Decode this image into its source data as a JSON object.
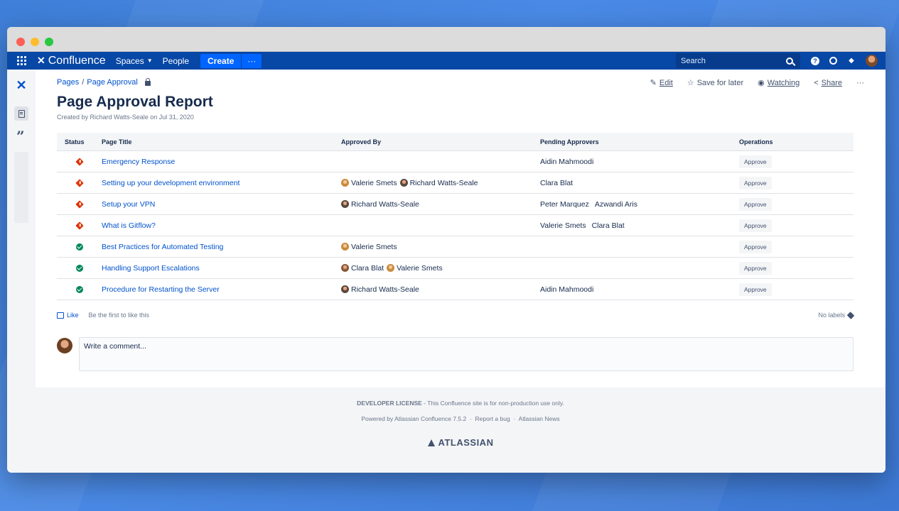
{
  "topnav": {
    "product": "Confluence",
    "spaces": "Spaces",
    "people": "People",
    "create": "Create",
    "more": "···",
    "search_placeholder": "Search"
  },
  "breadcrumb": {
    "root": "Pages",
    "sep": "/",
    "current": "Page Approval"
  },
  "actions": {
    "edit": "Edit",
    "save_later": "Save for later",
    "watching": "Watching",
    "share": "Share",
    "more": "···"
  },
  "page": {
    "title": "Page Approval Report",
    "byline": "Created by Richard Watts-Seale on Jul 31, 2020"
  },
  "table": {
    "headers": [
      "Status",
      "Page Title",
      "Approved By",
      "Pending Approvers",
      "Operations"
    ],
    "approve_label": "Approve",
    "rows": [
      {
        "status": "pending",
        "title": "Emergency Response",
        "approved": [],
        "pending": [
          "Aidin Mahmoodi"
        ]
      },
      {
        "status": "pending",
        "title": "Setting up your development environment",
        "approved": [
          {
            "name": "Valerie Smets",
            "avatar": "valerie"
          },
          {
            "name": "Richard Watts-Seale",
            "avatar": "richard"
          }
        ],
        "pending": [
          "Clara Blat"
        ]
      },
      {
        "status": "pending",
        "title": "Setup your VPN",
        "approved": [
          {
            "name": "Richard Watts-Seale",
            "avatar": "richard"
          }
        ],
        "pending": [
          "Peter Marquez",
          "Azwandi Aris"
        ]
      },
      {
        "status": "pending",
        "title": "What is Gitflow?",
        "approved": [],
        "pending": [
          "Valerie Smets",
          "Clara Blat"
        ]
      },
      {
        "status": "approved",
        "title": "Best Practices for Automated Testing",
        "approved": [
          {
            "name": "Valerie Smets",
            "avatar": "valerie"
          }
        ],
        "pending": []
      },
      {
        "status": "approved",
        "title": "Handling Support Escalations",
        "approved": [
          {
            "name": "Clara Blat",
            "avatar": "clara"
          },
          {
            "name": "Valerie Smets",
            "avatar": "valerie"
          }
        ],
        "pending": []
      },
      {
        "status": "approved",
        "title": "Procedure for Restarting the Server",
        "approved": [
          {
            "name": "Richard Watts-Seale",
            "avatar": "richard"
          }
        ],
        "pending": [
          "Aidin Mahmoodi"
        ]
      }
    ]
  },
  "likes": {
    "like": "Like",
    "text": "Be the first to like this",
    "labels": "No labels"
  },
  "comment": {
    "placeholder": "Write a comment..."
  },
  "footer": {
    "license_bold": "DEVELOPER LICENSE",
    "license_rest": " - This Confluence site is for non-production use only.",
    "powered": "Powered by Atlassian Confluence 7.5.2",
    "report": "Report a bug",
    "news": "Atlassian News",
    "dot": "·",
    "brand": "ATLASSIAN"
  },
  "colors": {
    "nav": "#0747a6",
    "link": "#0052cc",
    "pending": "#de350b",
    "approved": "#00875a"
  }
}
